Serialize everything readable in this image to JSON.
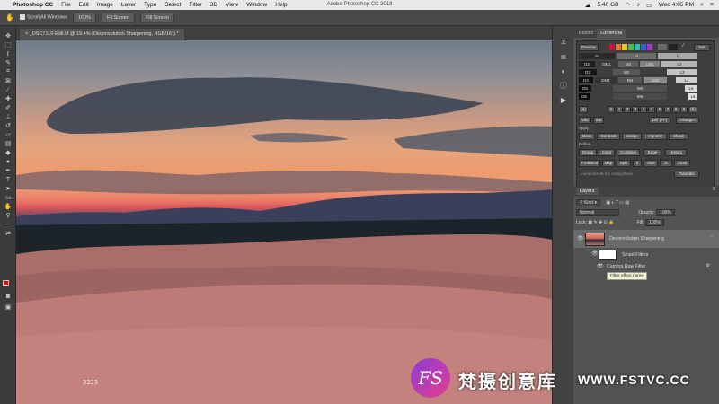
{
  "menubar": {
    "app_name": "Photoshop CC",
    "items": [
      "File",
      "Edit",
      "Image",
      "Layer",
      "Type",
      "Select",
      "Filter",
      "3D",
      "View",
      "Window",
      "Help"
    ],
    "window_title": "Adobe Photoshop CC 2018",
    "disk": "5.40 GB",
    "clock": "Wed 4:05 PM"
  },
  "options": {
    "scroll_all": "Scroll All Windows",
    "zoom": "100%",
    "fit_screen": "Fit Screen",
    "fill_screen": "Fill Screen"
  },
  "document": {
    "tab_label": "_DSC7110-Edit.tif @ 19.4% (Deconvolution Sharpening, RGB/16*) *",
    "overlay_number": "3333"
  },
  "panel_tabs": {
    "basics": "Basics",
    "lumenzia": "Lumenzia"
  },
  "lumenzia": {
    "preview": "Preview",
    "not": "Not",
    "zone_row1": [
      "D",
      "M",
      "L"
    ],
    "zone_row2": [
      "D2",
      "DM1",
      "M2",
      "LM1",
      "L2"
    ],
    "zone_row3": [
      "D3",
      "M3",
      "L3"
    ],
    "zone_row4": [
      "D4",
      "DM2",
      "M4",
      "LM2",
      "L4"
    ],
    "zone_row5": [
      "D5",
      "M5",
      "L5"
    ],
    "zone_row6": [
      "D6",
      "M6",
      "L6"
    ],
    "levels_label": "(a)",
    "levels": [
      "(a)",
      "0",
      "1",
      "2",
      "3",
      "4",
      "5",
      "6",
      "7",
      "8",
      "9",
      "(b)"
    ],
    "vibr": "Vibr",
    "sat": "Sat",
    "diff": "Diff (+/-)",
    "range": "<Range>",
    "apply_label": "Apply",
    "apply_buttons": [
      "Mask",
      "Contrast",
      "Dodge",
      "Vignette",
      "Sharp"
    ],
    "refine_label": "Refine",
    "refine_buttons": [
      "Group",
      "Color",
      "Combine",
      "Edge",
      "History"
    ],
    "misc_buttons": [
      "PreBlend",
      "Map",
      "Split",
      "If",
      "√Sel",
      "√L",
      "√Just"
    ],
    "version": "Lumenzia v6.0.1 Using Basic",
    "tutorials": "Tutorials"
  },
  "layers": {
    "title": "Layers",
    "kind": "Kind",
    "blend_mode": "Normal",
    "opacity_label": "Opacity:",
    "opacity": "100%",
    "lock_label": "Lock:",
    "fill_label": "Fill:",
    "fill": "100%",
    "rows": [
      {
        "name": "Deconvolution Sharpening"
      },
      {
        "name": "Smart Filters"
      },
      {
        "name": "Camera Raw Filter"
      }
    ],
    "tooltip": "Filter effect name"
  },
  "watermark": {
    "glyph": "FS",
    "chinese": "梵摄创意库",
    "url": "WWW.FSTVC.CC"
  },
  "colors": {
    "foreground": "#c0181a",
    "background": "#ffffff",
    "accent": "#e43f8d"
  }
}
